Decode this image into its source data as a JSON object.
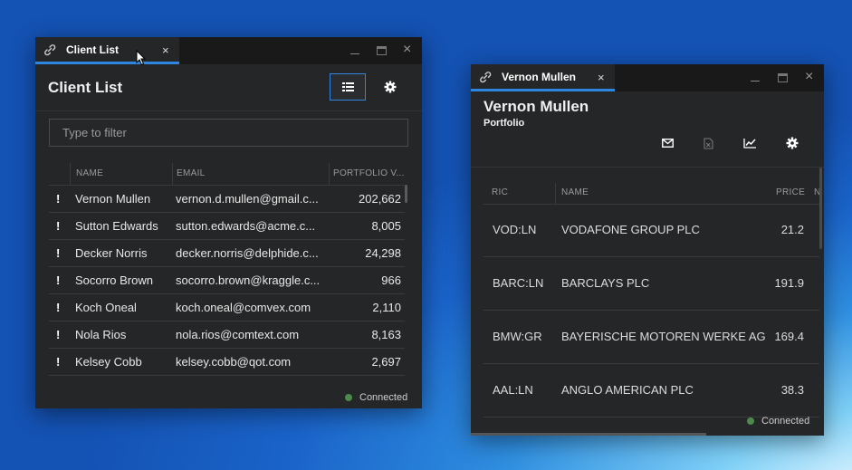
{
  "client_list": {
    "tab_title": "Client List",
    "heading": "Client List",
    "filter_placeholder": "Type to filter",
    "columns": [
      "NAME",
      "EMAIL",
      "PORTFOLIO V..."
    ],
    "rows": [
      {
        "name": "Vernon Mullen",
        "email": "vernon.d.mullen@gmail.c...",
        "portfolio_value": "202,662"
      },
      {
        "name": "Sutton Edwards",
        "email": "sutton.edwards@acme.c...",
        "portfolio_value": "8,005"
      },
      {
        "name": "Decker Norris",
        "email": "decker.norris@delphide.c...",
        "portfolio_value": "24,298"
      },
      {
        "name": "Socorro Brown",
        "email": "socorro.brown@kraggle.c...",
        "portfolio_value": "966"
      },
      {
        "name": "Koch Oneal",
        "email": "koch.oneal@comvex.com",
        "portfolio_value": "2,110"
      },
      {
        "name": "Nola Rios",
        "email": "nola.rios@comtext.com",
        "portfolio_value": "8,163"
      },
      {
        "name": "Kelsey Cobb",
        "email": "kelsey.cobb@qot.com",
        "portfolio_value": "2,697"
      }
    ],
    "status": "Connected"
  },
  "portfolio": {
    "tab_title": "Vernon Mullen",
    "heading": "Vernon Mullen",
    "subheading": "Portfolio",
    "columns": [
      "RIC",
      "NAME",
      "PRICE",
      "N"
    ],
    "rows": [
      {
        "ric": "VOD:LN",
        "name": "VODAFONE GROUP PLC",
        "price": "21.2"
      },
      {
        "ric": "BARC:LN",
        "name": "BARCLAYS PLC",
        "price": "191.9"
      },
      {
        "ric": "BMW:GR",
        "name": "BAYERISCHE MOTOREN WERKE AG",
        "price": "169.4"
      },
      {
        "ric": "AAL:LN",
        "name": "ANGLO AMERICAN PLC",
        "price": "38.3"
      }
    ],
    "status": "Connected"
  },
  "close_glyph": "×",
  "colors": {
    "accent": "#2f86e0",
    "window_bg": "#252627",
    "titlebar_bg": "#19191a",
    "connected": "#4b8a4b"
  }
}
